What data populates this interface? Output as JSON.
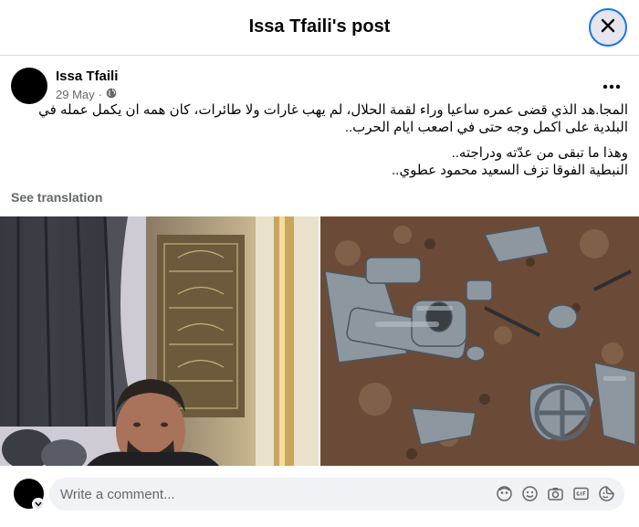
{
  "dialog": {
    "title": "Issa Tfaili's post"
  },
  "post": {
    "author": "Issa Tfaili",
    "date": "29 May",
    "date_separator": "·",
    "paragraph1": "المجا.هد الذي قضى عمره ساعيا وراء لقمة الحلال، لم يهب غارات ولا طائرات، كان همه ان يكمل عمله في البلدية على اكمل وجه حتى في اصعب ايام الحرب..",
    "paragraph2_line1": "وهذا ما تبقى من عدّته ودراجته..",
    "paragraph2_line2": "النبطية الفوقا تزف السعيد محمود عطوي..",
    "see_translation": "See translation"
  },
  "comment": {
    "placeholder": "Write a comment..."
  },
  "icons": {
    "close": "close-icon",
    "more": "more-options-icon",
    "audience": "globe-icon",
    "comment_tools": [
      "avatar-sticker-icon",
      "emoji-icon",
      "camera-icon",
      "gif-icon",
      "sticker-icon"
    ]
  },
  "colors": {
    "accent": "#1b74e4",
    "text_primary": "#050505",
    "text_secondary": "#65676b",
    "input_bg": "#f0f2f5",
    "divider": "#dadde1"
  }
}
